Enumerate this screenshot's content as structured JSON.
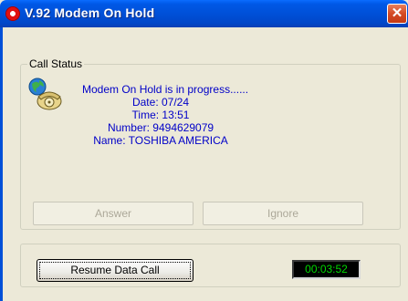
{
  "window": {
    "title": "V.92 Modem On Hold",
    "close_glyph": "✕",
    "accent_color": "#0050d8"
  },
  "call_status": {
    "group_label": "Call Status",
    "icon": "phone-globe-icon",
    "lines": {
      "progress": "Modem On Hold is in progress......",
      "date": "Date: 07/24",
      "time": "Time: 13:51",
      "number": "Number: 9494629079",
      "name": "Name: TOSHIBA AMERICA"
    },
    "text_color": "#0000c8"
  },
  "buttons": {
    "answer": "Answer",
    "ignore": "Ignore",
    "resume": "Resume Data Call"
  },
  "timer": {
    "value": "00:03:52",
    "color": "#00d800"
  }
}
